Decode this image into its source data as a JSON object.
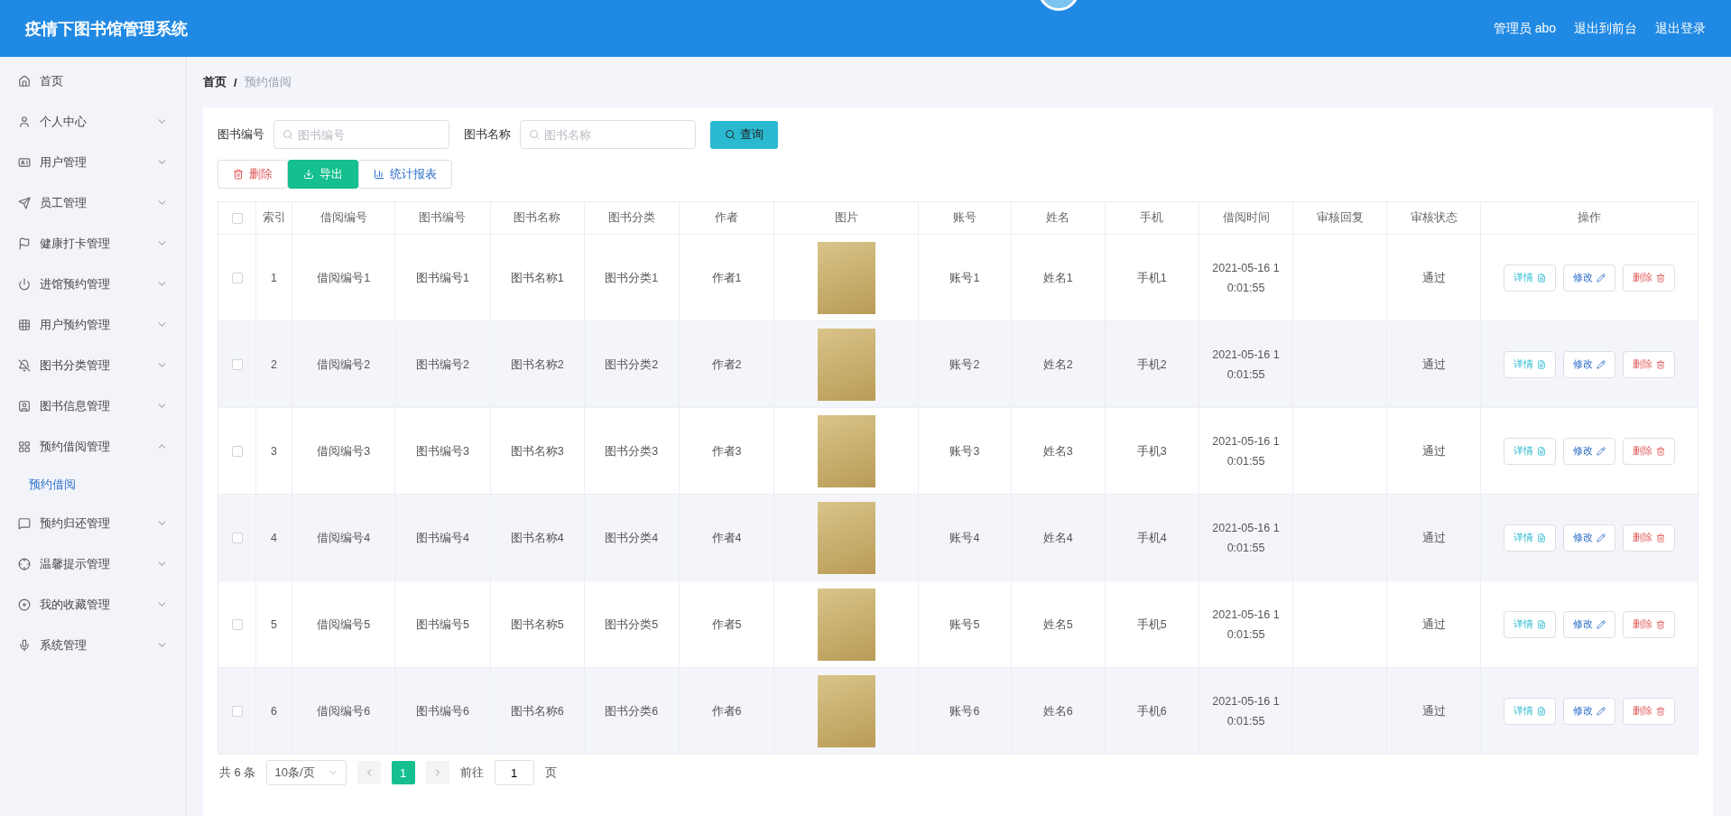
{
  "header": {
    "title": "疫情下图书馆管理系统",
    "links": [
      "管理员 abo",
      "退出到前台",
      "退出登录"
    ]
  },
  "sidebar": {
    "items": [
      {
        "label": "首页",
        "has_children": false
      },
      {
        "label": "个人中心",
        "expanded": false,
        "has_children": true
      },
      {
        "label": "用户管理",
        "expanded": false,
        "has_children": true
      },
      {
        "label": "员工管理",
        "expanded": false,
        "has_children": true
      },
      {
        "label": "健康打卡管理",
        "expanded": false,
        "has_children": true
      },
      {
        "label": "进馆预约管理",
        "expanded": false,
        "has_children": true
      },
      {
        "label": "用户预约管理",
        "expanded": false,
        "has_children": true
      },
      {
        "label": "图书分类管理",
        "expanded": false,
        "has_children": true
      },
      {
        "label": "图书信息管理",
        "expanded": false,
        "has_children": true
      },
      {
        "label": "预约借阅管理",
        "expanded": true,
        "has_children": true,
        "children": [
          {
            "label": "预约借阅",
            "selected": true
          }
        ]
      },
      {
        "label": "预约归还管理",
        "expanded": false,
        "has_children": true
      },
      {
        "label": "温馨提示管理",
        "expanded": false,
        "has_children": true
      },
      {
        "label": "我的收藏管理",
        "expanded": false,
        "has_children": true
      },
      {
        "label": "系统管理",
        "expanded": false,
        "has_children": true
      }
    ]
  },
  "breadcrumb": {
    "items": [
      "首页",
      "预约借阅"
    ],
    "separator": "/"
  },
  "search": {
    "fields": [
      {
        "label": "图书编号",
        "placeholder": "图书编号"
      },
      {
        "label": "图书名称",
        "placeholder": "图书名称"
      }
    ],
    "button": "查询"
  },
  "actions": [
    {
      "kind": "delete",
      "label": "删除"
    },
    {
      "kind": "export",
      "label": "导出"
    },
    {
      "kind": "chart",
      "label": "统计报表"
    }
  ],
  "table": {
    "select_all_checked": false,
    "columns": [
      "索引",
      "借阅编号",
      "图书编号",
      "图书名称",
      "图书分类",
      "作者",
      "图片",
      "账号",
      "姓名",
      "手机",
      "借阅时间",
      "审核回复",
      "审核状态",
      "操作"
    ],
    "rows": [
      {
        "checked": false,
        "cells": [
          "1",
          "借阅编号1",
          "图书编号1",
          "图书名称1",
          "图书分类1",
          "作者1",
          "",
          "账号1",
          "姓名1",
          "手机1",
          "2021-05-16 10:01:55",
          "",
          "通过"
        ],
        "actions": [
          {
            "kind": "detail",
            "label": "详情"
          },
          {
            "kind": "edit",
            "label": "修改"
          },
          {
            "kind": "delete",
            "label": "删除"
          }
        ]
      },
      {
        "checked": false,
        "cells": [
          "2",
          "借阅编号2",
          "图书编号2",
          "图书名称2",
          "图书分类2",
          "作者2",
          "",
          "账号2",
          "姓名2",
          "手机2",
          "2021-05-16 10:01:55",
          "",
          "通过"
        ],
        "actions": [
          {
            "kind": "detail",
            "label": "详情"
          },
          {
            "kind": "edit",
            "label": "修改"
          },
          {
            "kind": "delete",
            "label": "删除"
          }
        ]
      },
      {
        "checked": false,
        "cells": [
          "3",
          "借阅编号3",
          "图书编号3",
          "图书名称3",
          "图书分类3",
          "作者3",
          "",
          "账号3",
          "姓名3",
          "手机3",
          "2021-05-16 10:01:55",
          "",
          "通过"
        ],
        "actions": [
          {
            "kind": "detail",
            "label": "详情"
          },
          {
            "kind": "edit",
            "label": "修改"
          },
          {
            "kind": "delete",
            "label": "删除"
          }
        ]
      },
      {
        "checked": false,
        "cells": [
          "4",
          "借阅编号4",
          "图书编号4",
          "图书名称4",
          "图书分类4",
          "作者4",
          "",
          "账号4",
          "姓名4",
          "手机4",
          "2021-05-16 10:01:55",
          "",
          "通过"
        ],
        "actions": [
          {
            "kind": "detail",
            "label": "详情"
          },
          {
            "kind": "edit",
            "label": "修改"
          },
          {
            "kind": "delete",
            "label": "删除"
          }
        ]
      },
      {
        "checked": false,
        "cells": [
          "5",
          "借阅编号5",
          "图书编号5",
          "图书名称5",
          "图书分类5",
          "作者5",
          "",
          "账号5",
          "姓名5",
          "手机5",
          "2021-05-16 10:01:55",
          "",
          "通过"
        ],
        "actions": [
          {
            "kind": "detail",
            "label": "详情"
          },
          {
            "kind": "edit",
            "label": "修改"
          },
          {
            "kind": "delete",
            "label": "删除"
          }
        ]
      },
      {
        "checked": false,
        "cells": [
          "6",
          "借阅编号6",
          "图书编号6",
          "图书名称6",
          "图书分类6",
          "作者6",
          "",
          "账号6",
          "姓名6",
          "手机6",
          "2021-05-16 10:01:55",
          "",
          "通过"
        ],
        "actions": [
          {
            "kind": "detail",
            "label": "详情"
          },
          {
            "kind": "edit",
            "label": "修改"
          },
          {
            "kind": "delete",
            "label": "删除"
          }
        ]
      }
    ]
  },
  "pagination": {
    "total": "共 6 条",
    "page_size": "10条/页",
    "pages": [
      {
        "label": "1",
        "selected": true
      }
    ],
    "goto_label": "前往",
    "goto_value": "1",
    "goto_suffix": "页"
  }
}
